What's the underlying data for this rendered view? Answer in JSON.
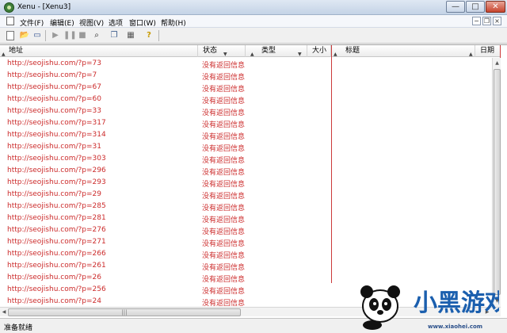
{
  "window": {
    "title": "Xenu - [Xenu3]",
    "controls": {
      "minimize": "—",
      "maximize": "□",
      "close": "✕"
    }
  },
  "menu": {
    "items": [
      "文件(F)",
      "编辑(E)",
      "视图(V)",
      "选项",
      "窗口(W)",
      "帮助(H)"
    ],
    "mdi_controls": {
      "minimize": "−",
      "restore": "❐",
      "close": "×"
    }
  },
  "toolbar": {
    "icons": [
      "new-document-icon",
      "open-folder-icon",
      "save-disk-icon",
      "play-icon",
      "pause-icon",
      "stop-icon",
      "binoculars-icon",
      "copy-icon",
      "properties-icon",
      "help-question-icon"
    ],
    "glyphs": {
      "open": "📂",
      "save": "▭",
      "play": "▶",
      "pause": "❚❚",
      "stop": "■",
      "find": "⌕",
      "copy": "❐",
      "props": "▦",
      "help": "?"
    }
  },
  "table": {
    "columns": [
      {
        "label": "地址"
      },
      {
        "label": "状态"
      },
      {
        "label": "类型"
      },
      {
        "label": "大小"
      },
      {
        "label": "标题"
      },
      {
        "label": "日期"
      }
    ],
    "rows": [
      {
        "url": "http://seojishu.com/?p=73",
        "status": "没有返回信息"
      },
      {
        "url": "http://seojishu.com/?p=7",
        "status": "没有返回信息"
      },
      {
        "url": "http://seojishu.com/?p=67",
        "status": "没有返回信息"
      },
      {
        "url": "http://seojishu.com/?p=60",
        "status": "没有返回信息"
      },
      {
        "url": "http://seojishu.com/?p=33",
        "status": "没有返回信息"
      },
      {
        "url": "http://seojishu.com/?p=317",
        "status": "没有返回信息"
      },
      {
        "url": "http://seojishu.com/?p=314",
        "status": "没有返回信息"
      },
      {
        "url": "http://seojishu.com/?p=31",
        "status": "没有返回信息"
      },
      {
        "url": "http://seojishu.com/?p=303",
        "status": "没有返回信息"
      },
      {
        "url": "http://seojishu.com/?p=296",
        "status": "没有返回信息"
      },
      {
        "url": "http://seojishu.com/?p=293",
        "status": "没有返回信息"
      },
      {
        "url": "http://seojishu.com/?p=29",
        "status": "没有返回信息"
      },
      {
        "url": "http://seojishu.com/?p=285",
        "status": "没有返回信息"
      },
      {
        "url": "http://seojishu.com/?p=281",
        "status": "没有返回信息"
      },
      {
        "url": "http://seojishu.com/?p=276",
        "status": "没有返回信息"
      },
      {
        "url": "http://seojishu.com/?p=271",
        "status": "没有返回信息"
      },
      {
        "url": "http://seojishu.com/?p=266",
        "status": "没有返回信息"
      },
      {
        "url": "http://seojishu.com/?p=261",
        "status": "没有返回信息"
      },
      {
        "url": "http://seojishu.com/?p=26",
        "status": "没有返回信息"
      },
      {
        "url": "http://seojishu.com/?p=256",
        "status": "没有返回信息"
      },
      {
        "url": "http://seojishu.com/?p=24",
        "status": "没有返回信息"
      }
    ]
  },
  "scroll": {
    "up": "▲",
    "down": "▼",
    "left": "◀",
    "right": "▶",
    "grip": "|||"
  },
  "status_bar": {
    "text": "准备就绪"
  },
  "watermark": {
    "brand": "小黑游戏",
    "url": "www.xiaohei.com"
  },
  "colors": {
    "link_red": "#cc2b2b",
    "highlight": "#cc3a3a"
  }
}
